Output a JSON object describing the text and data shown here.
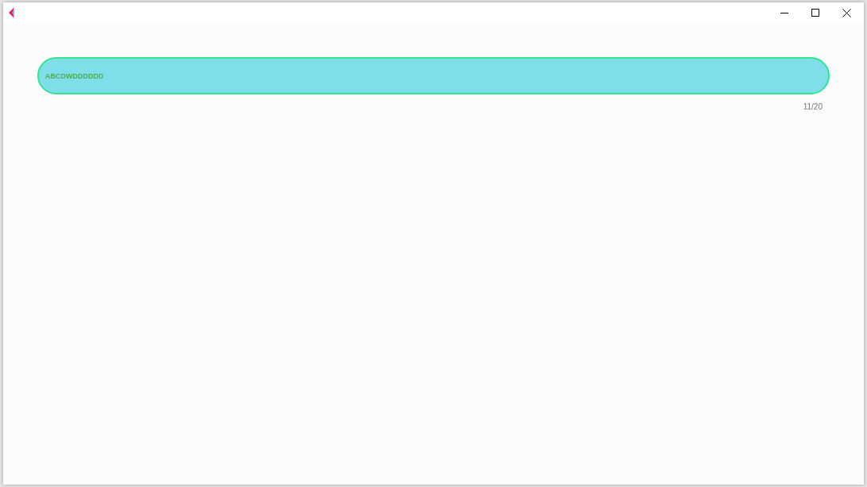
{
  "field": {
    "value": "ABCDWDDDDDD",
    "counter": "11/20"
  }
}
